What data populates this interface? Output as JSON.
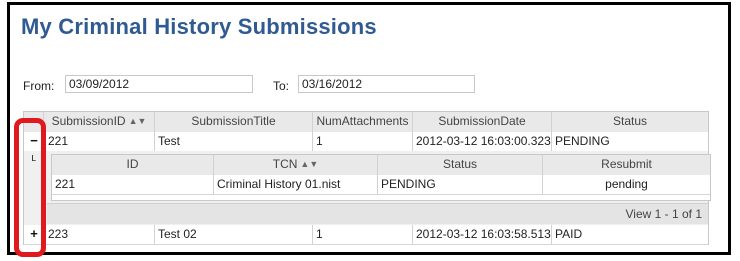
{
  "page": {
    "title": "My Criminal History Submissions"
  },
  "filters": {
    "from_label": "From:",
    "from_value": "03/09/2012",
    "to_label": "To:",
    "to_value": "03/16/2012"
  },
  "main_grid": {
    "columns": [
      "SubmissionID",
      "SubmissionTitle",
      "NumAttachments",
      "SubmissionDate",
      "Status"
    ],
    "rows": [
      {
        "expand": "−",
        "SubmissionID": "221",
        "SubmissionTitle": "Test",
        "NumAttachments": "1",
        "SubmissionDate": "2012-03-12 16:03:00.323",
        "Status": "PENDING"
      },
      {
        "expand": "+",
        "SubmissionID": "223",
        "SubmissionTitle": "Test 02",
        "NumAttachments": "1",
        "SubmissionDate": "2012-03-12 16:03:58.513",
        "Status": "PAID"
      }
    ]
  },
  "sub_grid": {
    "marker": "ᴸ",
    "columns": [
      "ID",
      "TCN",
      "Status",
      "Resubmit"
    ],
    "rows": [
      {
        "ID": "221",
        "TCN": "Criminal History 01.nist",
        "Status": "PENDING",
        "Resubmit": "pending"
      }
    ],
    "pager": "View 1 - 1 of 1"
  },
  "icons": {
    "sort": "sort-icon",
    "expand": "expand-icon",
    "collapse": "collapse-icon"
  },
  "colors": {
    "title": "#2f5a92",
    "highlight": "#e0191e",
    "header_bg": "#e9e9e9"
  }
}
